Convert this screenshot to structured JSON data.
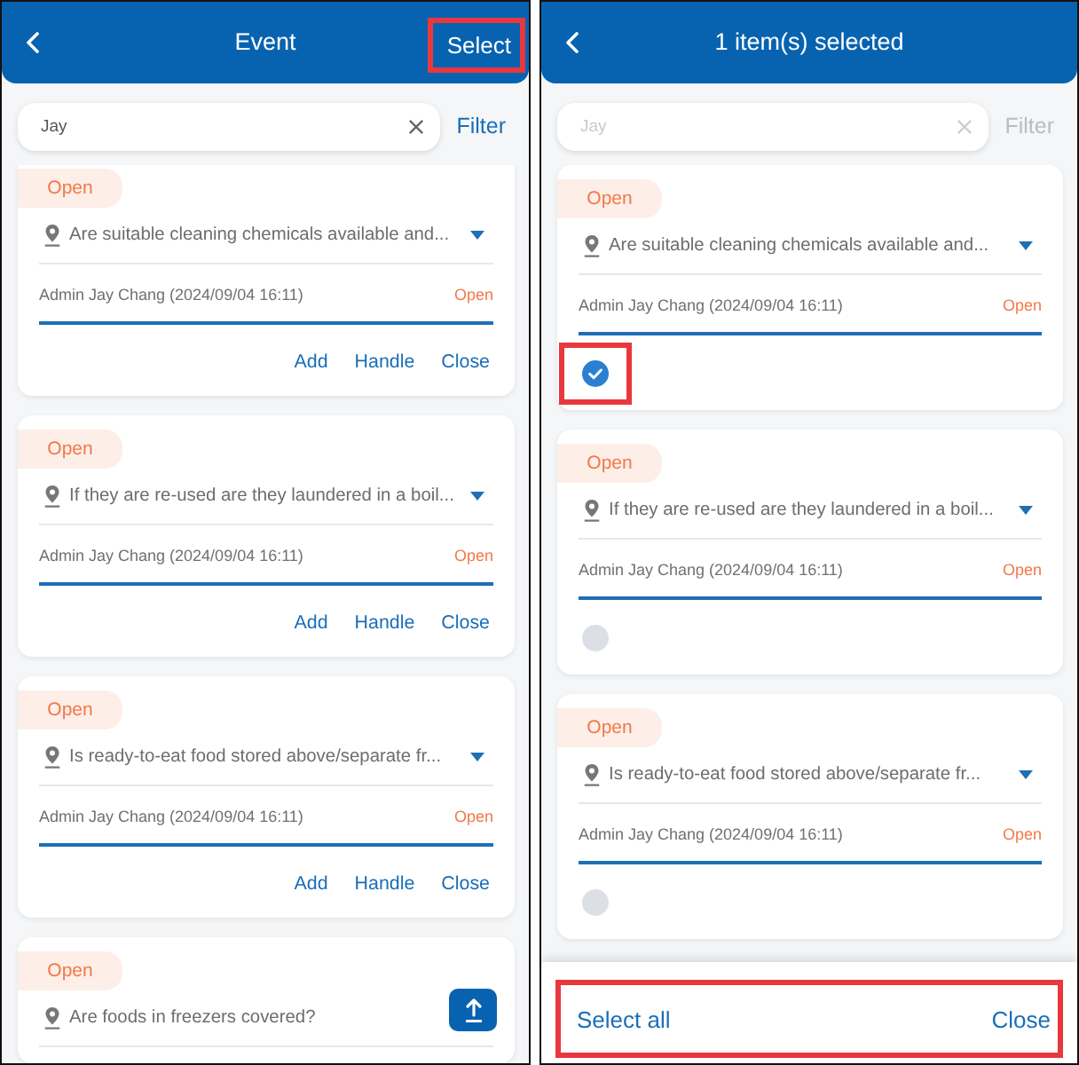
{
  "screens": [
    {
      "kind": "browse",
      "header": {
        "title": "Event",
        "action": {
          "label": "Select",
          "highlighted": true
        }
      },
      "search": {
        "value": "Jay",
        "disabled": false
      },
      "filter": {
        "label": "Filter",
        "disabled": false
      },
      "events": [
        {
          "status": "Open",
          "question": "Are suitable cleaning chemicals available and...",
          "author": "Admin Jay Chang (2024/09/04 16:11)",
          "state": "Open",
          "actions": [
            "Add",
            "Handle",
            "Close"
          ]
        },
        {
          "status": "Open",
          "question": "If they are re-used are they laundered in a boil...",
          "author": "Admin Jay Chang (2024/09/04 16:11)",
          "state": "Open",
          "actions": [
            "Add",
            "Handle",
            "Close"
          ]
        },
        {
          "status": "Open",
          "question": "Is ready-to-eat food stored above/separate fr...",
          "author": "Admin Jay Chang (2024/09/04 16:11)",
          "state": "Open",
          "actions": [
            "Add",
            "Handle",
            "Close"
          ]
        },
        {
          "status": "Open",
          "question": "Are foods in freezers covered?"
        }
      ],
      "scroll_top_button": true
    },
    {
      "kind": "select",
      "header": {
        "title": "1 item(s) selected"
      },
      "search": {
        "value": "Jay",
        "disabled": true
      },
      "filter": {
        "label": "Filter",
        "disabled": true
      },
      "events": [
        {
          "status": "Open",
          "question": "Are suitable cleaning chemicals available and...",
          "author": "Admin Jay Chang (2024/09/04 16:11)",
          "state": "Open",
          "checked": true,
          "highlighted": true
        },
        {
          "status": "Open",
          "question": "If they are re-used are they laundered in a boil...",
          "author": "Admin Jay Chang (2024/09/04 16:11)",
          "state": "Open",
          "checked": false,
          "highlighted": false
        },
        {
          "status": "Open",
          "question": "Is ready-to-eat food stored above/separate fr...",
          "author": "Admin Jay Chang (2024/09/04 16:11)",
          "state": "Open",
          "checked": false,
          "highlighted": false
        }
      ],
      "bottom_bar": {
        "select_all": "Select all",
        "close": "Close",
        "highlighted": true
      }
    }
  ]
}
